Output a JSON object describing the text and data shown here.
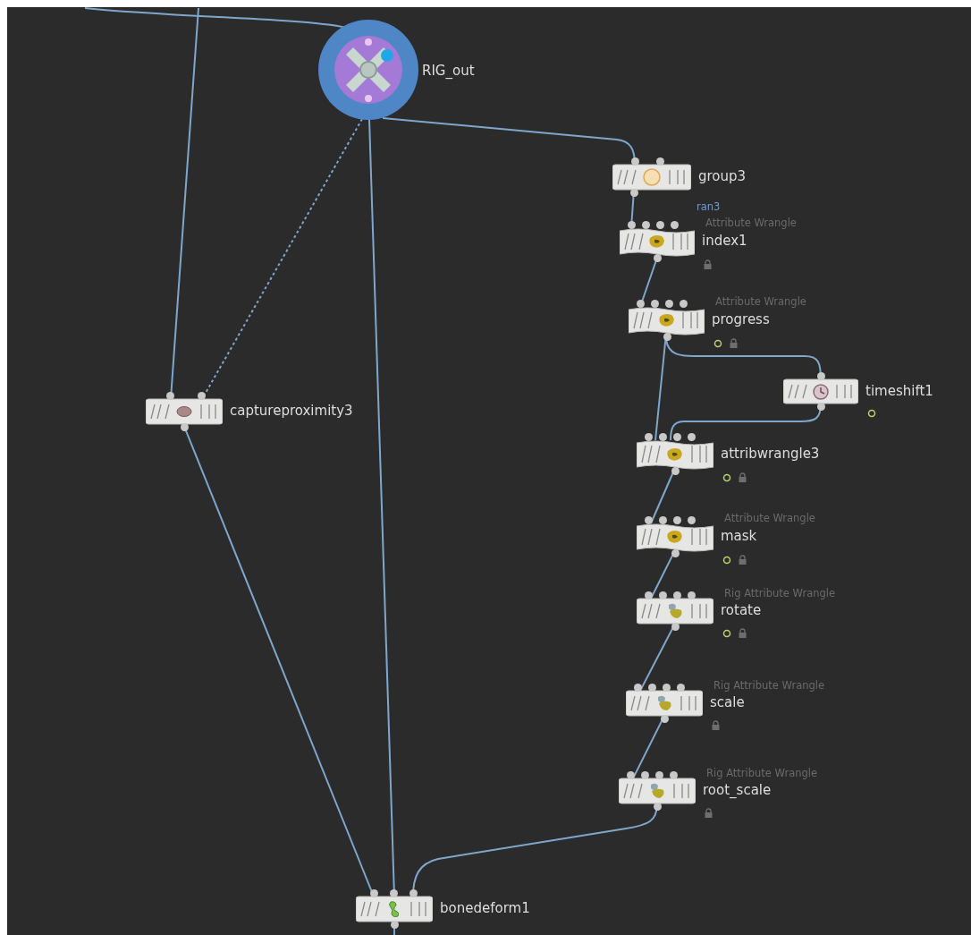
{
  "network": {
    "nodes": [
      {
        "name": "RIG_out",
        "kind": "output"
      },
      {
        "name": "group3",
        "kind": "group"
      },
      {
        "name": "index1",
        "kind": "wrangle",
        "type_label": "Attribute Wrangle",
        "input_label": "ran3",
        "locked": true
      },
      {
        "name": "progress",
        "kind": "wrangle",
        "type_label": "Attribute Wrangle",
        "time_dependent": true,
        "locked": true
      },
      {
        "name": "captureproximity3",
        "kind": "capture"
      },
      {
        "name": "timeshift1",
        "kind": "timeshift",
        "time_dependent": true
      },
      {
        "name": "attribwrangle3",
        "kind": "wrangle",
        "time_dependent": true,
        "locked": true
      },
      {
        "name": "mask",
        "kind": "wrangle",
        "type_label": "Attribute Wrangle",
        "time_dependent": true,
        "locked": true
      },
      {
        "name": "rotate",
        "kind": "rig_wrangle",
        "type_label": "Rig Attribute Wrangle",
        "time_dependent": true,
        "locked": true
      },
      {
        "name": "scale",
        "kind": "rig_wrangle",
        "type_label": "Rig Attribute Wrangle",
        "locked": true
      },
      {
        "name": "root_scale",
        "kind": "rig_wrangle",
        "type_label": "Rig Attribute Wrangle",
        "locked": true
      },
      {
        "name": "bonedeform1",
        "kind": "deform"
      }
    ]
  }
}
